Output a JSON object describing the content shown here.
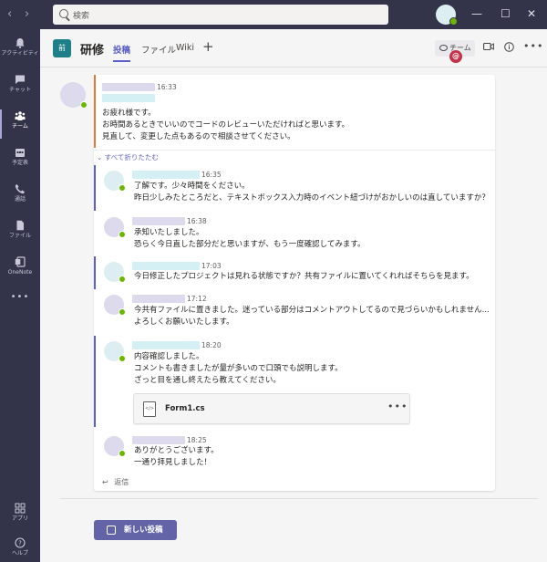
{
  "titlebar": {
    "back": "‹",
    "forward": "›",
    "search_placeholder": "検索",
    "minimize": "—",
    "maximize": "☐",
    "close": "✕"
  },
  "rail": [
    {
      "label": "アクティビティ",
      "icon": "bell-icon"
    },
    {
      "label": "チャット",
      "icon": "chat-icon"
    },
    {
      "label": "チーム",
      "icon": "teams-icon",
      "active": true
    },
    {
      "label": "予定表",
      "icon": "calendar-icon"
    },
    {
      "label": "通話",
      "icon": "phone-icon"
    },
    {
      "label": "ファイル",
      "icon": "file-icon"
    },
    {
      "label": "OneNote",
      "icon": "onenote-icon"
    },
    {
      "label": "•••",
      "icon": "more-icon"
    }
  ],
  "rail_bottom": [
    {
      "label": "アプリ",
      "icon": "apps-icon"
    },
    {
      "label": "ヘルプ",
      "icon": "help-icon"
    }
  ],
  "channel": {
    "tile": "前",
    "name": "研修",
    "tabs": [
      "投稿",
      "ファイル",
      "Wiki"
    ],
    "add": "+",
    "team_button": "チーム",
    "more": "•••"
  },
  "colors": {
    "accent": "#5b5fc7",
    "rail_bg": "#33344a",
    "root_bar": "#e07a3f",
    "status_available": "#6bb700",
    "mention": "#c4314b"
  },
  "root_message": {
    "time": "16:33",
    "lines": [
      "お疲れ様です。",
      "お時間あるときでいいのでコードのレビューいただければと思います。",
      "見直して、変更した点もあるので相談させてください。"
    ],
    "mention": "@"
  },
  "collapse_all": "⌄ すべて折りたたむ",
  "replies": [
    {
      "time": "16:35",
      "avatar": "#ddeef3",
      "name": "#d4f0f5",
      "lines": [
        "了解です。少々時間をください。",
        "昨日少しみたところだと、テキストボックス入力時のイベント紐づけがおかしいのは直していますか？"
      ],
      "bar": true
    },
    {
      "time": "16:38",
      "avatar": "#dcdaec",
      "name": "#dcdaec",
      "lines": [
        "承知いたしました。",
        "恐らく今日直した部分だと思いますが、もう一度確認してみます。"
      ],
      "bar": false
    },
    {
      "time": "17:03",
      "avatar": "#ddeef3",
      "name": "#d4f0f5",
      "lines": [
        "今日修正したプロジェクトは見れる状態ですか？共有ファイルに置いてくれればそちらを見ます。"
      ],
      "bar": true
    },
    {
      "time": "17:12",
      "avatar": "#dcdaec",
      "name": "#dcdaec",
      "lines": [
        "今共有ファイルに置きました。迷っている部分はコメントアウトしてるので見づらいかもしれません...",
        "よろしくお願いいたします。"
      ],
      "bar": false
    },
    {
      "time": "18:20",
      "avatar": "#ddeef3",
      "name": "#d4f0f5",
      "lines": [
        "内容確認しました。",
        "コメントも書きましたが量が多いので口頭でも説明します。",
        "ざっと目を通し終えたら教えてください。"
      ],
      "bar": true
    },
    {
      "time": "18:25",
      "avatar": "#dcdaec",
      "name": "#dcdaec",
      "lines": [
        "ありがとうございます。",
        "一通り拝見しました！"
      ],
      "bar": false
    }
  ],
  "attachment": {
    "name": "Form1.cs",
    "more": "•••"
  },
  "reply_label": "返信",
  "reply_arrow": "↩",
  "new_post": "新しい投稿"
}
